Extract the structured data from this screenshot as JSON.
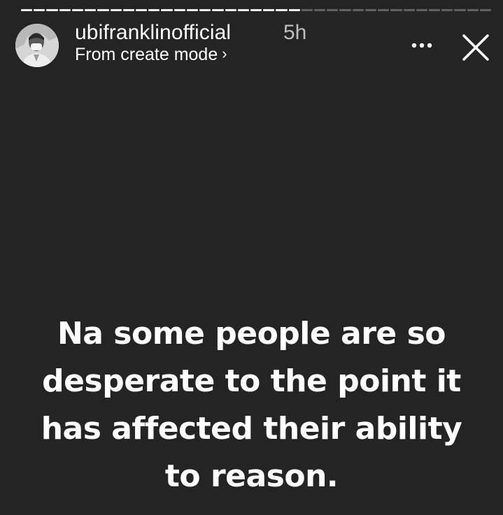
{
  "story": {
    "username": "ubifranklinofficial",
    "time_ago": "5h",
    "source_label": "From create mode",
    "source_chevron": "›",
    "text_lines": [
      "Na some people are so",
      "desperate to the point it",
      "has affected their ability",
      "to reason."
    ]
  },
  "progress": {
    "total_segments": 37,
    "completed_segments": 22
  },
  "icons": {
    "more": "more-horizontal-icon",
    "close": "close-icon",
    "avatar": "profile-photo"
  },
  "colors": {
    "background": "#242424",
    "text": "#ffffff",
    "muted_text": "#bdbdbd",
    "progress_active": "#ebebeb",
    "progress_inactive": "#5c5c5c"
  }
}
